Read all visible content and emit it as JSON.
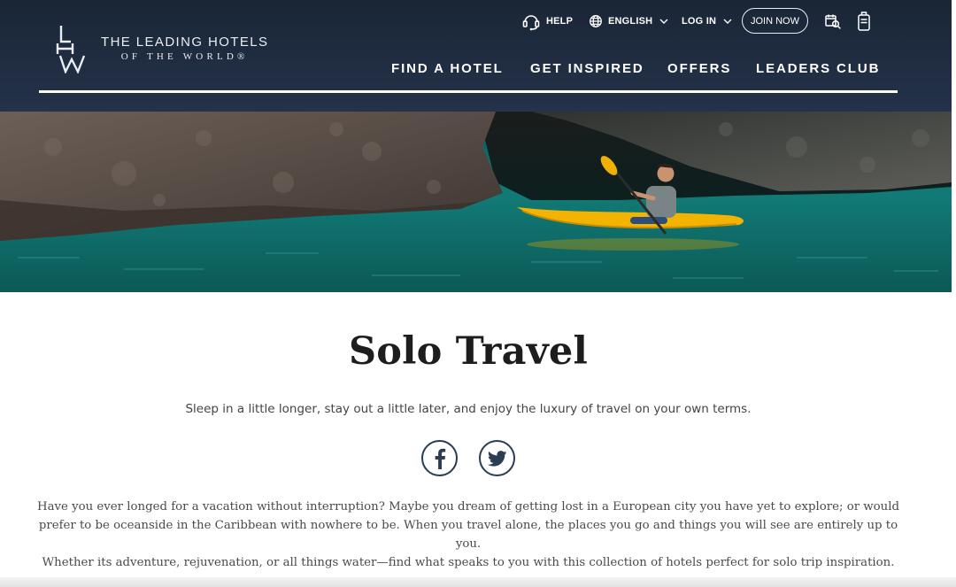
{
  "brand": {
    "monogram": "LHW",
    "line1": "THE LEADING HOTELS",
    "line2": "OF THE WORLD®"
  },
  "utility_nav": {
    "help": "HELP",
    "language": "ENGLISH",
    "login": "LOG IN",
    "join": "JOIN NOW"
  },
  "main_nav": [
    "FIND A HOTEL",
    "GET INSPIRED",
    "OFFERS",
    "LEADERS CLUB"
  ],
  "page": {
    "title": "Solo Travel",
    "subtitle": "Sleep in a little longer, stay out a little later, and enjoy the luxury of travel on your own terms.",
    "body_lines": [
      "Have you ever longed for a vacation without interruption? Maybe you dream of getting lost in a European city you have yet to explore; or would",
      "prefer to be oceanside in the Caribbean with nowhere to be. When you travel alone, the places you go and things you will see are entirely up to you.",
      "Whether its adventure, rejuvenation, or all things water—find what speaks to you with this collection of hotels perfect for solo trip inspiration."
    ]
  },
  "icons": {
    "help": "headset-icon",
    "language": "globe-icon",
    "search": "search-hotel-icon",
    "bag": "luggage-icon",
    "facebook": "facebook-icon",
    "twitter": "twitter-icon"
  },
  "colors": {
    "header_bg": "#1f2c3f",
    "social_ring": "#2b3d53",
    "title_text": "#1d1d1d",
    "kayak": "#f2b400",
    "water": "#0e6d6a"
  }
}
